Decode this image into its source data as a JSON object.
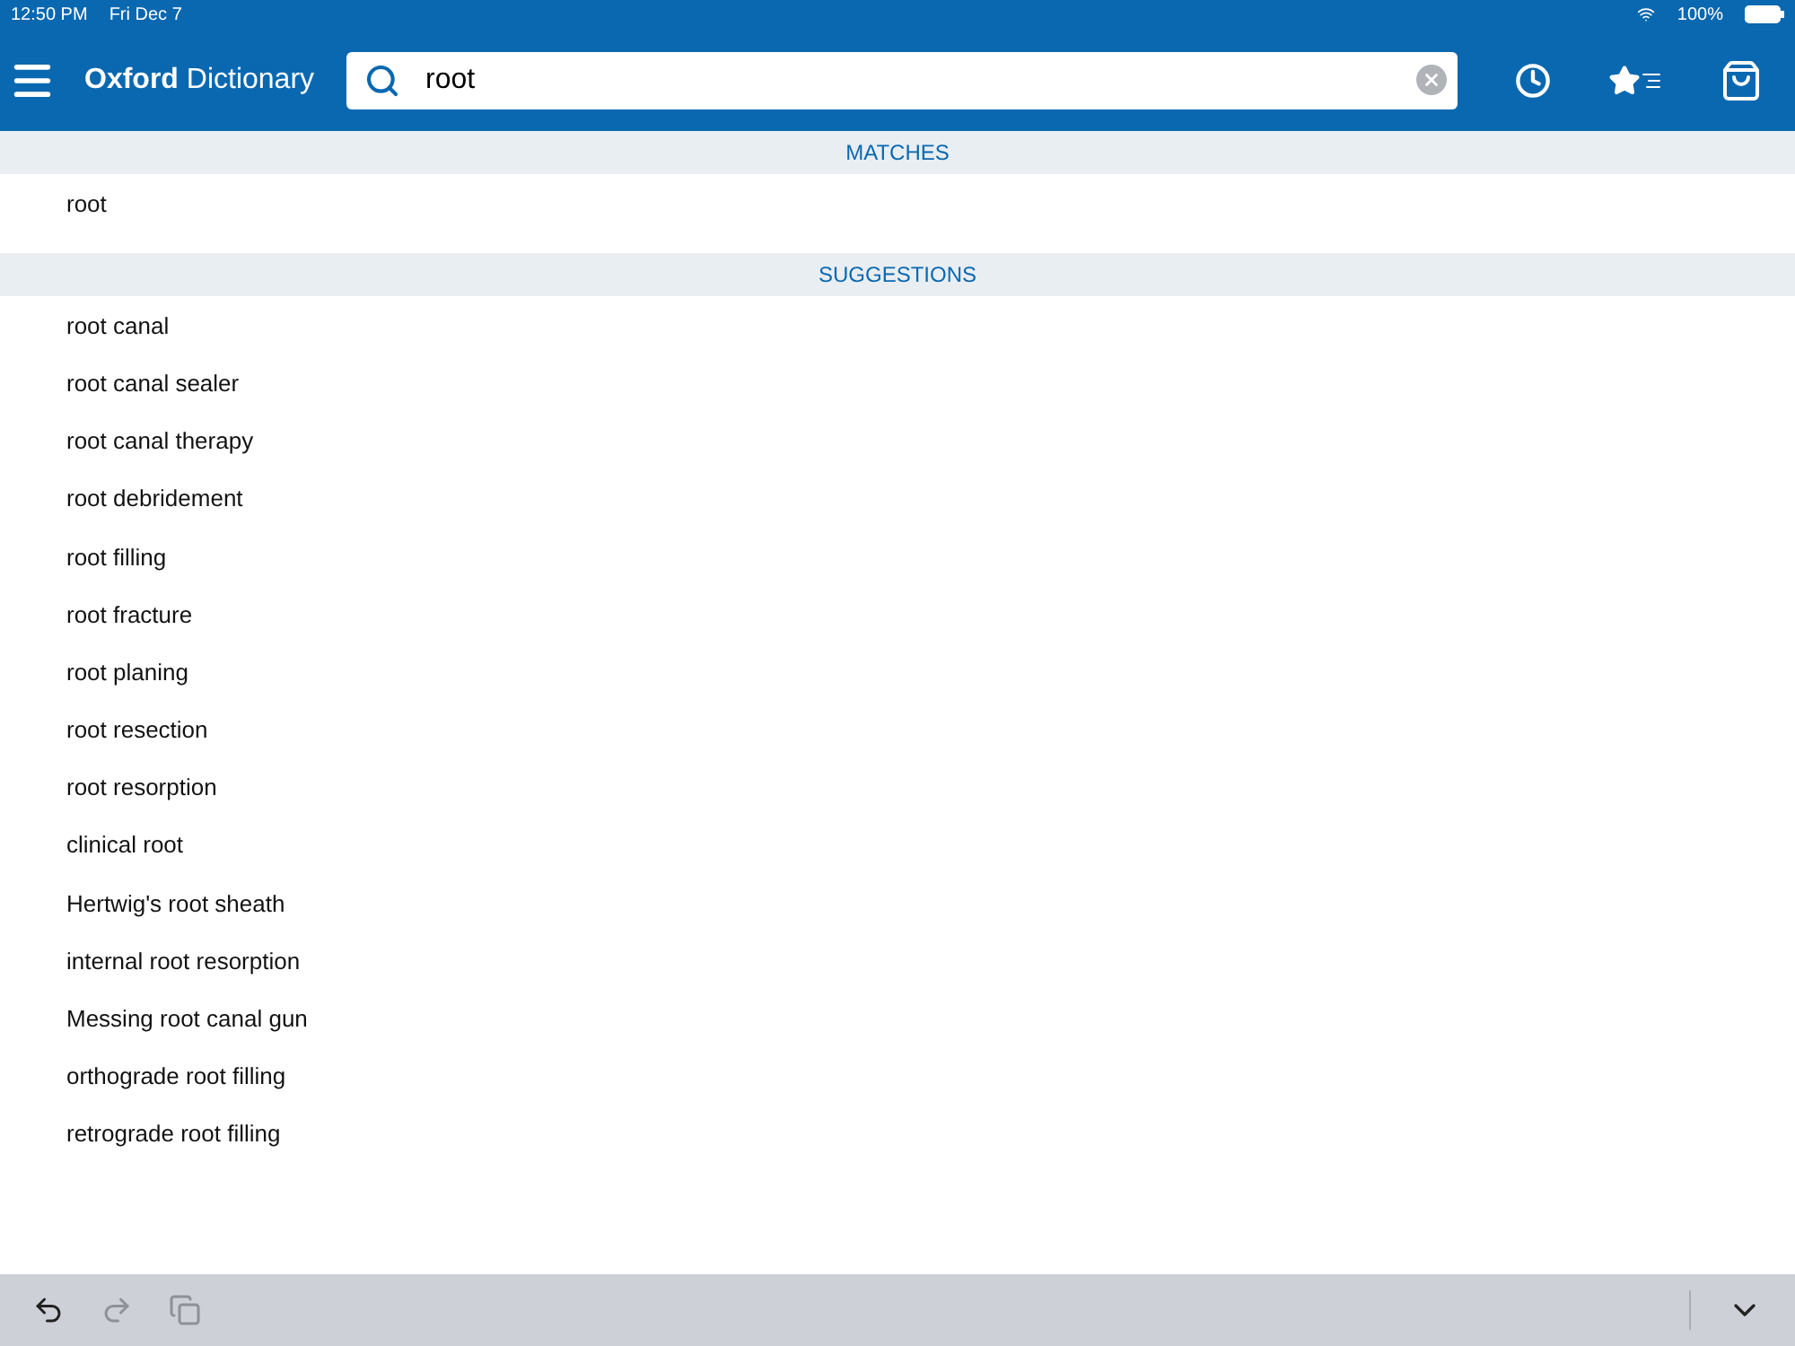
{
  "status_bar": {
    "time": "12:50 PM",
    "date": "Fri Dec 7",
    "battery": "100%"
  },
  "header": {
    "title": "**Oxford** Dictionary",
    "search": {
      "value": "root"
    }
  },
  "sections": [
    {
      "title": "MATCHES",
      "items": [
        "root"
      ]
    },
    {
      "title": "SUGGESTIONS",
      "items": [
        "root canal",
        "root canal sealer",
        "root canal therapy",
        "root debridement",
        "root filling",
        "root fracture",
        "root planing",
        "root resection",
        "root resorption",
        "clinical root",
        "Hertwig's root sheath",
        "internal root resorption",
        "Messing root canal gun",
        "orthograde root filling",
        "retrograde root filling"
      ]
    }
  ],
  "keyboard_bar": {
    "buttons": [
      {
        "kind": "undo",
        "disabled": false
      },
      {
        "kind": "redo",
        "disabled": true
      },
      {
        "kind": "paste",
        "disabled": true
      }
    ]
  }
}
